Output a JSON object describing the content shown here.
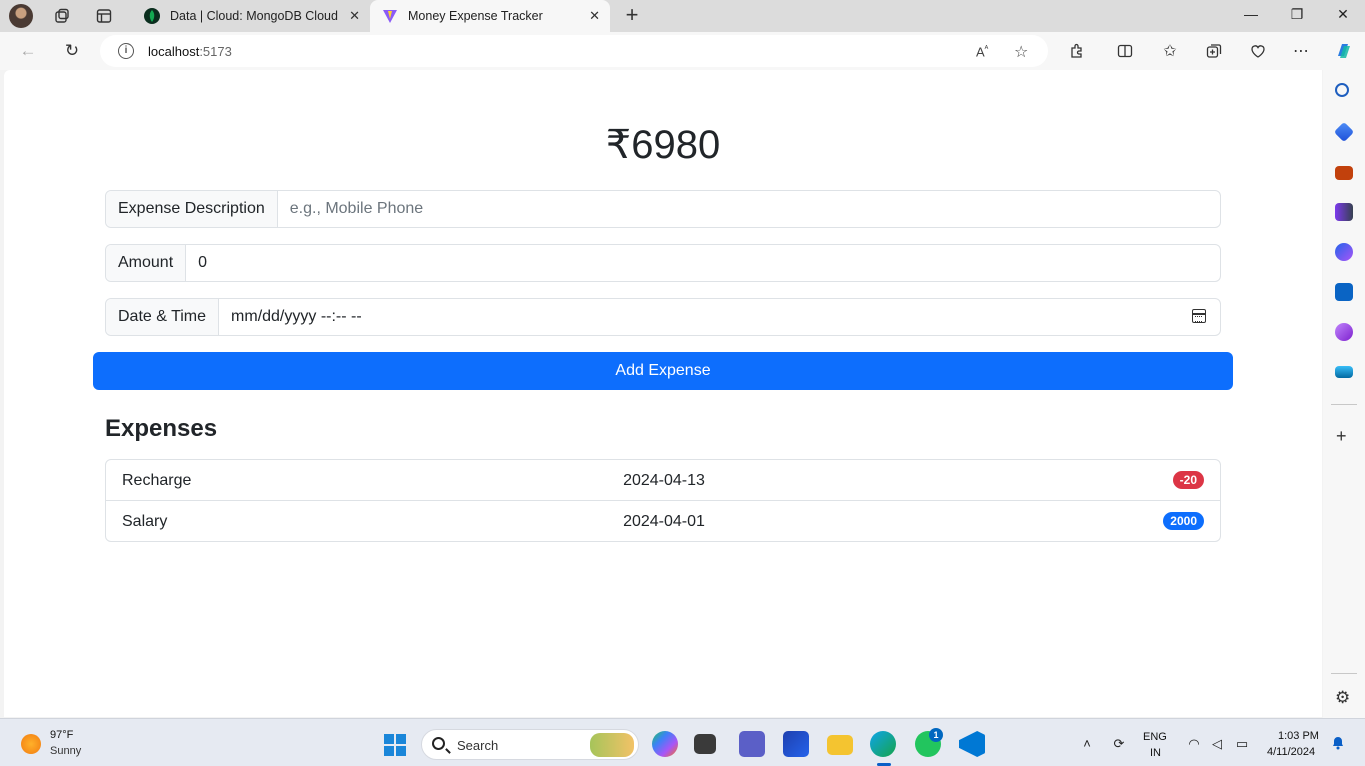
{
  "browser": {
    "tabs": [
      {
        "title": "Data | Cloud: MongoDB Cloud",
        "active": false
      },
      {
        "title": "Money Expense Tracker",
        "active": true
      }
    ],
    "url_host": "localhost",
    "url_port": ":5173"
  },
  "app": {
    "balance": "₹6980",
    "fields": {
      "description_label": "Expense Description",
      "description_placeholder": "e.g., Mobile Phone",
      "amount_label": "Amount",
      "amount_value": "0",
      "datetime_label": "Date & Time",
      "datetime_value": "mm/dd/yyyy --:-- --"
    },
    "add_button": "Add Expense",
    "expenses_title": "Expenses",
    "expenses": [
      {
        "description": "Recharge",
        "date": "2024-04-13",
        "amount": "-20",
        "badge_color": "#dc3545"
      },
      {
        "description": "Salary",
        "date": "2024-04-01",
        "amount": "2000",
        "badge_color": "#0d6efd"
      }
    ],
    "accent_color": "#0d6efd"
  },
  "taskbar": {
    "weather_temp": "97°F",
    "weather_condition": "Sunny",
    "search_label": "Search",
    "notification_count": "1",
    "language": "ENG",
    "region": "IN",
    "time": "1:03 PM",
    "date": "4/11/2024"
  }
}
